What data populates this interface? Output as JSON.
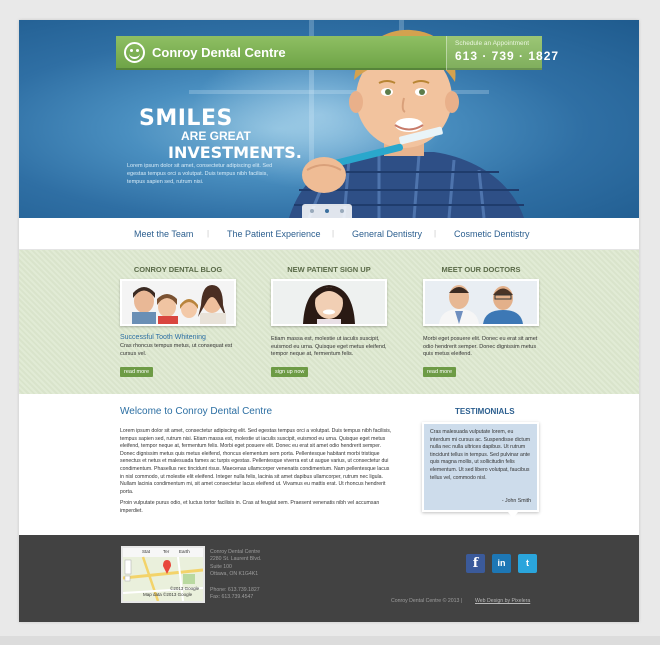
{
  "header": {
    "brand_name": "Conroy Dental Centre",
    "appointment_label": "Schedule an Appointment",
    "phone": "613 · 739 · 1827"
  },
  "hero": {
    "headline_1": "SMILES",
    "headline_2": "ARE GREAT",
    "headline_3": "INVESTMENTS.",
    "body": "Lorem ipsum dolor sit amet, consectetur adipiscing elit. Sed egestas tempus orci a volutpat. Duis tempus nibh facilisis, tempus sapien sed, rutrum nisi."
  },
  "nav": {
    "items": [
      "Meet the Team",
      "The Patient Experience",
      "General Dentistry",
      "Cosmetic Dentistry"
    ],
    "separator": "|"
  },
  "features": [
    {
      "title": "CONROY DENTAL BLOG",
      "link": "Successful Tooth Whitening",
      "text": "Cras rhoncus tempus metus, ut consequat est cursus vel.",
      "button": "read more"
    },
    {
      "title": "NEW PATIENT SIGN UP",
      "link": "",
      "text": "Etiam massa est, molestie ut iaculis suscipit, euismod eu urna. Quisque eget metus eleifend, tempor neque at, fermentum felis.",
      "button": "sign up now"
    },
    {
      "title": "MEET OUR DOCTORS",
      "link": "",
      "text": "Morbi eget posuere elit. Donec eu erat sit amet odio hendrerit semper. Donec dignissim metus quis metus eleifend.",
      "button": "read more"
    }
  ],
  "welcome": {
    "title": "Welcome to Conroy Dental Centre",
    "body": "Lorem ipsum dolor sit amet, consectetur adipiscing elit. Sed egestas tempus orci a volutpat. Duis tempus nibh facilisis, tempus sapien sed, rutrum nisi. Etiam massa est, molestie ut iaculis suscipit, euismod eu urna. Quisque eget metus eleifend, tempor neque at, fermentum felis. Morbi eget posuere elit. Donec eu erat sit amet odio hendrerit semper. Donec dignissim metus quis metus eleifend, rhoncus elementum sem porta. Pellentesque habitant morbi tristique senectus et netus et malesuada fames ac turpis egestas. Pellentesque viverra est ut augue varius, ut consectetur dui condimentum. Phasellus nec tincidunt risus. Maecenas ullamcorper venenatis condimentum. Nam pellentesque lacus in nisl commodo, ut molestie elit eleifend. Integer nulla felis, lacinia sit amet dapibus ullamcorper, rutrum nec ligula. Nullam lacinia condimentum mi, sit amet consectetur lacus eleifend ut. Vivamus eu mattis erat. Ut rhoncus hendrerit porta.",
    "body_2": "Proin vulputate purus odio, et luctus tortor facilisis in. Cras at feugiat sem. Praesent venenatis nibh vel accumsan imperdiet."
  },
  "testimonials": {
    "title": "TESTIMONIALS",
    "text": "Cras malesuada vulputate lorem, eu interdum mi cursus ac. Suspendisse dictum nulla nec nulla ultrices dapibus. Ut rutrum tincidunt tellus in tempus. Sed pulvinar ante quis magna mollis, ut sollicitudin felis elementum. Ut sed libero volutpat, faucibus tellus vel, commodo nisl.",
    "author": "- John Smith"
  },
  "footer": {
    "map_labels": [
      "Stat",
      "Ter",
      "Earth",
      "Map data ©2013 Google",
      "©2013 Google"
    ],
    "address": [
      "Conroy Dental Centre",
      "2280 St. Laurent Blvd.",
      "Suite 100",
      "Ottawa, ON K1G4K1"
    ],
    "phone": "Phone: 613.739.1827",
    "fax": "Fax: 613.739.4547",
    "copyright": "Conroy Dental Centre © 2013",
    "separator": "|",
    "design_credit": "Web Design by Pixelera",
    "social": [
      "facebook-icon",
      "linkedin-icon",
      "twitter-icon"
    ],
    "social_glyphs": [
      "f",
      "in",
      "t"
    ]
  },
  "colors": {
    "brand_green": "#6fa447",
    "hero_blue": "#2f6fa4",
    "link_blue": "#2c6fa3",
    "band_green": "#dde8cf",
    "footer_dark": "#424242"
  }
}
